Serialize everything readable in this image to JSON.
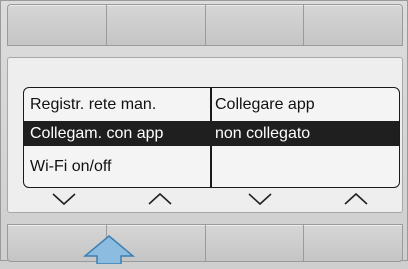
{
  "menu": {
    "rows": [
      {
        "left": "Registr. rete man.",
        "right": "Collegare app"
      },
      {
        "left": "Collegam. con app",
        "right": "non collegato"
      },
      {
        "left": "Wi-Fi on/off",
        "right": ""
      }
    ]
  },
  "nav": {
    "arrows": [
      "chevron-down-icon",
      "chevron-up-icon",
      "chevron-down-icon",
      "chevron-up-icon"
    ]
  },
  "colors": {
    "highlight": "#1f1f1f",
    "pointer_arrow": "#7fb2d9"
  }
}
